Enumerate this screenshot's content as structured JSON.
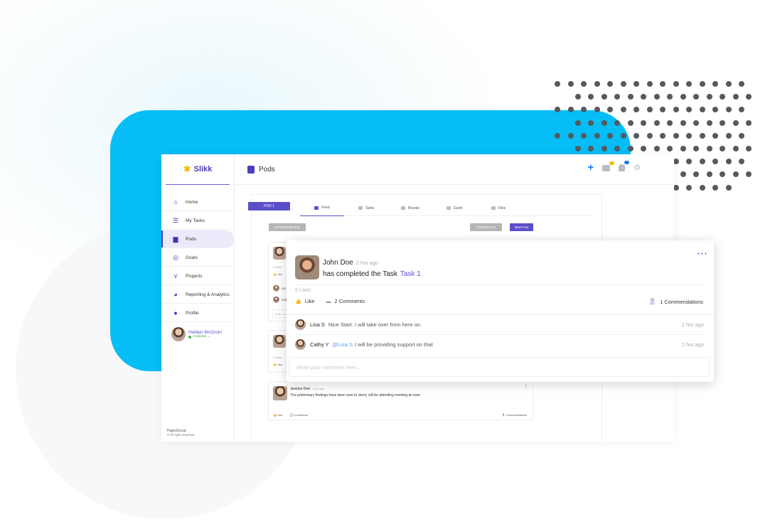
{
  "app": {
    "logo_text": "Slikk",
    "page_title": "Pods"
  },
  "sidebar": {
    "items": [
      {
        "label": "Home",
        "icon": "home-icon"
      },
      {
        "label": "My Tasks",
        "icon": "list-icon"
      },
      {
        "label": "Pods",
        "icon": "pod-icon",
        "active": true
      },
      {
        "label": "Goals",
        "icon": "target-icon"
      },
      {
        "label": "Projects",
        "icon": "network-icon"
      },
      {
        "label": "Reporting & Analytics",
        "icon": "pie-chart-icon"
      },
      {
        "label": "Profile",
        "icon": "person-icon"
      }
    ],
    "user": {
      "name": "Holden McGroin",
      "status": "Available"
    },
    "footer": {
      "org": "HapisGroup",
      "copyright": "© All right reserved"
    }
  },
  "content": {
    "pod_tab": "POD 1",
    "tabs": [
      {
        "label": "Feed",
        "active": true
      },
      {
        "label": "Tasks"
      },
      {
        "label": "Boards"
      },
      {
        "label": "Gantt"
      },
      {
        "label": "Files"
      }
    ],
    "buttons": {
      "schedule": "Schedule Meeting",
      "event": "Create Event",
      "post": "New Post"
    },
    "bg_card1": {
      "likes": "5 Likes",
      "like": "Like",
      "commenters": [
        "Lis",
        "Cat"
      ],
      "placeholder": "Write your"
    },
    "bg_card2": {
      "likes": "5 Likes",
      "like": "Like"
    },
    "bottom_card": {
      "name": "Jessica Doe",
      "time": "2 hrs ago",
      "text": "The preliminary findings have been sent to client, will be attending meeting at noon",
      "like": "Like",
      "comments": "Comments",
      "commendations": "Commendations"
    }
  },
  "post": {
    "author": "John Doe",
    "time": "2 hrs ago",
    "text": "has completed the Task",
    "task_link": "Task 1",
    "likes": "5 Likes",
    "like_label": "Like",
    "comments_label": "2 Comments",
    "commendations_label": "1 Commendations",
    "comments": [
      {
        "author": "Lisa S",
        "mention": "",
        "text": "Nice Start. I will take over from here on.",
        "time": "2 hrs ago"
      },
      {
        "author": "Cathy Y",
        "mention": "@Lisa S",
        "text": "I will be providing support on that",
        "time": "2 hrs ago"
      }
    ],
    "comment_placeholder": "Write your comment here..."
  },
  "colors": {
    "brand": "#5b4fc9",
    "accent_blue": "#06bdf5",
    "action_blue": "#1c7fe6"
  }
}
